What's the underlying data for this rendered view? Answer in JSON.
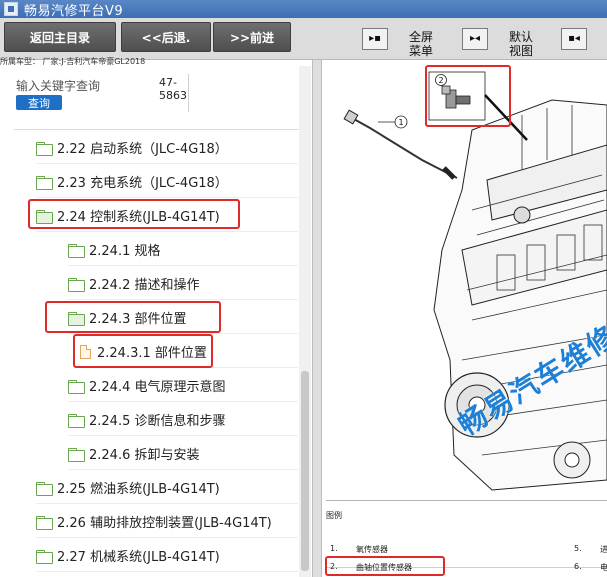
{
  "window": {
    "title": "畅易汽修平台V9"
  },
  "toolbar": {
    "home_label": "返回主目录",
    "back_label": "<<后退.",
    "forward_label": ">>前进",
    "fullscreen_label": "全屏菜单",
    "default_view_label": "默认视图"
  },
  "vehicle_info": "所属车型：  厂家:J-吉利汽车帝豪GL2018",
  "search": {
    "label": "输入关键字查询",
    "button": "查询"
  },
  "doc_code": {
    "line1": "47-",
    "line2": "5863"
  },
  "tree": {
    "items": [
      {
        "label": "2.22 启动系统（JLC-4G18）"
      },
      {
        "label": "2.23 充电系统（JLC-4G18）"
      },
      {
        "label": "2.24 控制系统(JLB-4G14T)"
      },
      {
        "label": "2.24.1 规格"
      },
      {
        "label": "2.24.2 描述和操作"
      },
      {
        "label": "2.24.3 部件位置"
      },
      {
        "label": "2.24.3.1 部件位置"
      },
      {
        "label": "2.24.4 电气原理示意图"
      },
      {
        "label": "2.24.5 诊断信息和步骤"
      },
      {
        "label": "2.24.6 拆卸与安装"
      },
      {
        "label": "2.25 燃油系统(JLB-4G14T)"
      },
      {
        "label": "2.26 辅助排放控制装置(JLB-4G14T)"
      },
      {
        "label": "2.27 机械系统(JLB-4G14T)"
      }
    ]
  },
  "figure": {
    "callout_1": "1",
    "callout_2": "2",
    "watermark": "畅易汽车维修"
  },
  "legend": {
    "title": "图例",
    "rows": [
      {
        "num": "1.",
        "text": "氧传感器"
      },
      {
        "num": "2.",
        "text": "曲轴位置传感器"
      },
      {
        "num": "5.",
        "text": "进"
      },
      {
        "num": "6.",
        "text": "电"
      }
    ]
  },
  "colors": {
    "highlight": "#e02a2a",
    "titlebar": "#3d6fb4",
    "search_button": "#1f6fc6",
    "watermark": "#1d7fd6"
  }
}
